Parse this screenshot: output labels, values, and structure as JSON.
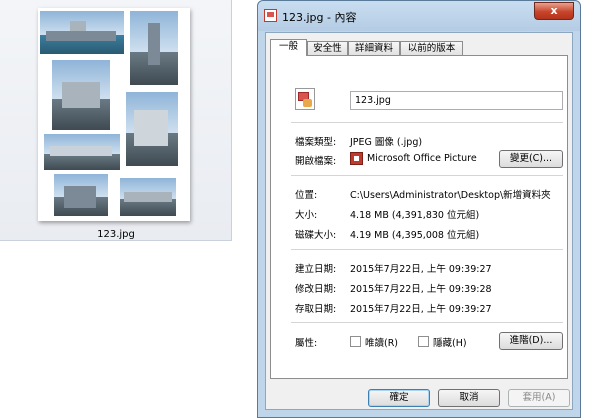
{
  "explorer": {
    "file_name": "123.jpg"
  },
  "window": {
    "title": "123.jpg - 內容",
    "close_label": "x"
  },
  "tabs": [
    {
      "label": "一般"
    },
    {
      "label": "安全性"
    },
    {
      "label": "詳細資料"
    },
    {
      "label": "以前的版本"
    }
  ],
  "general": {
    "file_name_value": "123.jpg",
    "type_label": "檔案類型:",
    "type_value": "JPEG 圖像 (.jpg)",
    "opens_with_label": "開啟檔案:",
    "opens_with_value": "Microsoft Office Picture",
    "change_button": "變更(C)...",
    "location_label": "位置:",
    "location_value": "C:\\Users\\Administrator\\Desktop\\新增資料夾",
    "size_label": "大小:",
    "size_value": "4.18 MB (4,391,830 位元組)",
    "size_on_disk_label": "磁碟大小:",
    "size_on_disk_value": "4.19 MB (4,395,008 位元組)",
    "created_label": "建立日期:",
    "created_value": "2015年7月22日, 上午 09:39:27",
    "modified_label": "修改日期:",
    "modified_value": "2015年7月22日, 上午 09:39:28",
    "accessed_label": "存取日期:",
    "accessed_value": "2015年7月22日, 上午 09:39:27",
    "attributes_label": "屬性:",
    "readonly_label": "唯讀(R)",
    "hidden_label": "隱藏(H)",
    "advanced_button": "進階(D)..."
  },
  "footer": {
    "ok": "確定",
    "cancel": "取消",
    "apply": "套用(A)"
  }
}
